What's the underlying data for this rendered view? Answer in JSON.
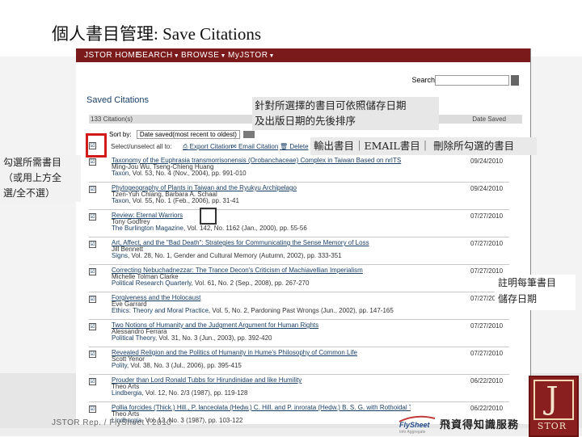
{
  "slide": {
    "title_zh": "個人書目管理",
    "title_en": ": Save Citations",
    "footer": "JSTOR  Rep. / FlySheet  l  2010"
  },
  "jstor": {
    "nav": {
      "home": "JSTOR HOME",
      "search": "SEARCH",
      "browse": "BROWSE",
      "myjstor": "MyJSTOR"
    },
    "search_label": "Search",
    "saved_title": "Saved Citations",
    "table_head": {
      "count": "133 Citation(s)",
      "date_col": "Date Saved"
    },
    "sort": {
      "label": "Sort by:",
      "value": "Date saved(most recent to oldest)"
    },
    "actions": {
      "select_label": "Select/unselect all to:",
      "export": "Export Citation",
      "email": "Email Citation",
      "delete": "Delete"
    },
    "citations": [
      {
        "title": "Taxonomy of the Euphrasia transmorrisonensis (Orobanchaceae) Complex in Taiwan Based on nrITS",
        "authors": "Ming-Jou Wu, Tseng-Chieng Huang",
        "journal": "Taxon",
        "source": ", Vol. 53, No. 4 (Nov., 2004), pp. 991-010",
        "date": "09/24/2010"
      },
      {
        "title": "Phytogeography of Plants in Taiwan and the Ryukyu Archipelago",
        "authors": "Tzen-Yuh Chiang, Barbara A. Schaal",
        "journal": "Taxon",
        "source": ", Vol. 55, No. 1 (Feb., 2006), pp. 31-41",
        "date": "09/24/2010"
      },
      {
        "title": "Review: Eternal Warriors",
        "authors": "Tony Godfrey",
        "journal": "The Burlington Magazine",
        "source": ", Vol. 142, No. 1162 (Jan., 2000), pp. 55-56",
        "date": "07/27/2010"
      },
      {
        "title": "Art, Affect, and the \"Bad Death\": Strategies for Communicating the Sense Memory of Loss",
        "authors": "Jill Bennett",
        "journal": "Signs",
        "source": ", Vol. 28, No. 1, Gender and Cultural Memory (Autumn, 2002), pp. 333-351",
        "date": "07/27/2010"
      },
      {
        "title": "Correcting Nebuchadnezzar: The Trance Decon's Criticism of Machiavellian Imperialism",
        "authors": "Michelle Tolman Clarke",
        "journal": "Political Research Quarterly",
        "source": ", Vol. 61, No. 2 (Sep., 2008), pp. 267-270",
        "date": "07/27/2010"
      },
      {
        "title": "Forgiveness and the Holocaust",
        "authors": "Eve Garrard",
        "journal": "Ethics: Theory and Moral Practice",
        "source": ", Vol. 5, No. 2, Pardoning Past Wrongs (Jun., 2002), pp. 147-165",
        "date": "07/27/2010"
      },
      {
        "title": "Two Notions of Humanity and the Judgment Argument for Human Rights",
        "authors": "Alessandro Ferrara",
        "journal": "Political Theory",
        "source": ", Vol. 31, No. 3 (Jun., 2003), pp. 392-420",
        "date": "07/27/2010"
      },
      {
        "title": "Revealed Religion and the Politics of Humanity in Hume's Philosophy of Common Life",
        "authors": "Scott Yenor",
        "journal": "Polity",
        "source": ", Vol. 38, No. 3 (Jul., 2006), pp. 395-415",
        "date": "07/27/2010"
      },
      {
        "title": "Prouder than Lord Ronald Tubbs for Hirundinidae and like Humility",
        "authors": "Theo Arts",
        "journal": "Lindbergia",
        "source": ", Vol. 12, No. 2/3 (1987), pp. 119-128",
        "date": "06/22/2010"
      },
      {
        "title": "Pollia forcides (Thick.) Hill., P. lanceolata (Hedw.) C. Hill. and P. inrorata (Hedw.) B. S. G. with Rothoidal Tubers",
        "authors": "Theo Arts",
        "journal": "Lindbergia",
        "source": ", Vol. 13, No. 3 (1987), pp. 103-122",
        "date": "06/22/2010"
      }
    ]
  },
  "callouts": {
    "sort_line1": "針對所選擇的書目可依照儲存日期",
    "sort_line2": "及出版日期的先後排序",
    "actions": "輸出書目｜EMAIL書目｜ 刪除所勾選的書目",
    "select_line1": "勾選所需書目",
    "select_line2": "（或用上方全",
    "select_line3": "選/全不選）",
    "date_line1": "註明每筆書目",
    "date_line2": "儲存日期"
  },
  "branding": {
    "flysheet": "FlySheet",
    "flysheet_sub": "Info Aggregate",
    "company_zh": "飛資得知識服務",
    "jstor_word": "STOR",
    "jstor_j": "J"
  },
  "colors": {
    "nav_bg": "#7b1a1a",
    "link": "#1a3f66",
    "highlight_red": "#d21a1a",
    "jstor_red": "#8a1f1f"
  }
}
